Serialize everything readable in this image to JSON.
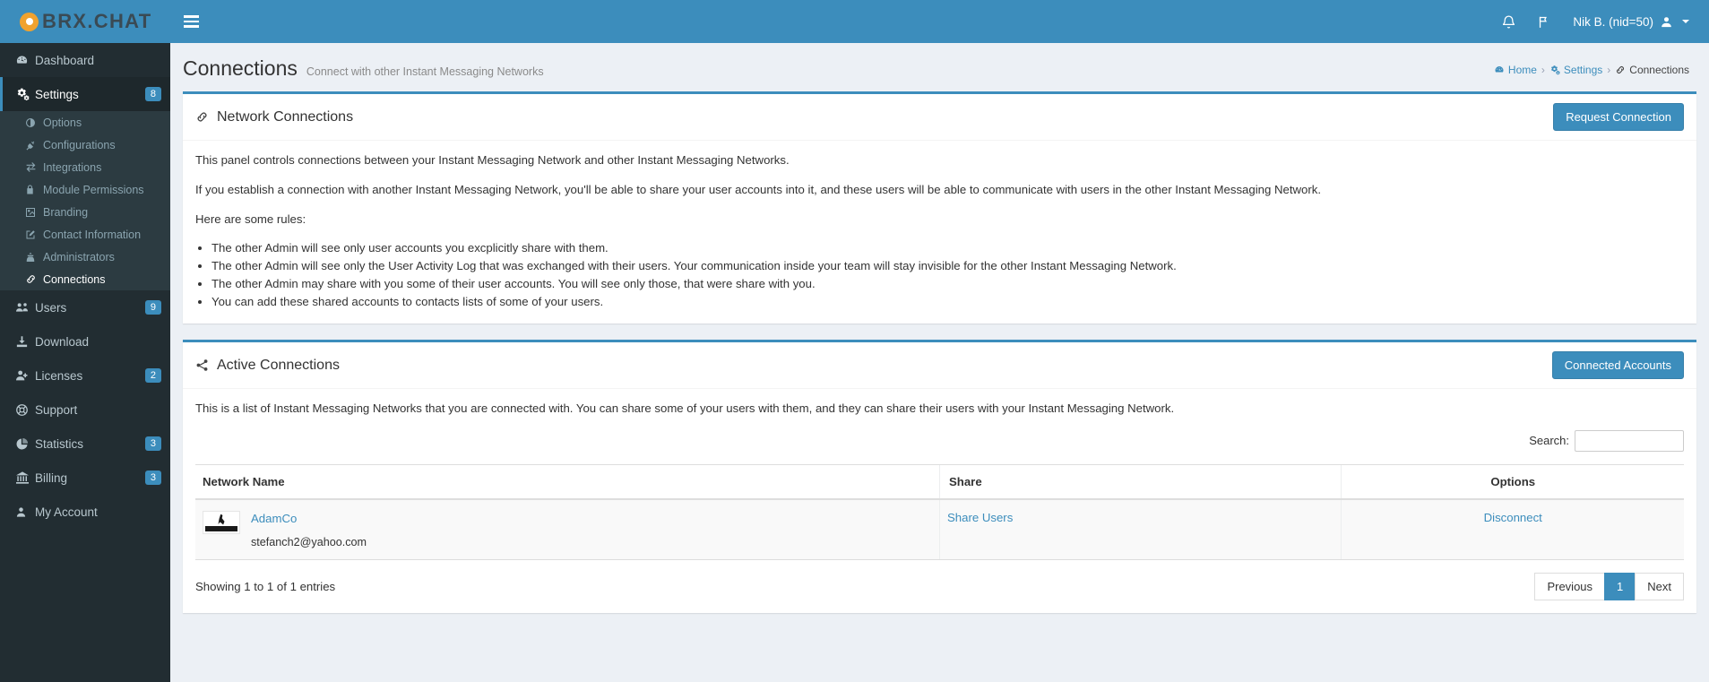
{
  "brand": {
    "name": "BRX.CHAT",
    "logo_icon": "circle-dot-icon",
    "accent": "#3c8dbc"
  },
  "topbar": {
    "menu_toggle_icon": "hamburger-icon",
    "bell_icon": "bell-icon",
    "flag_icon": "flag-icon",
    "user_label": "Nik B. (nid=50)",
    "user_icon": "user-icon",
    "caret_icon": "caret-down-icon"
  },
  "sidebar": {
    "items": [
      {
        "label": "Dashboard",
        "icon": "dashboard-icon",
        "badge": "",
        "active": false
      },
      {
        "label": "Settings",
        "icon": "gears-icon",
        "badge": "8",
        "active": true
      },
      {
        "label": "Users",
        "icon": "users-icon",
        "badge": "9",
        "active": false
      },
      {
        "label": "Download",
        "icon": "download-icon",
        "badge": "",
        "active": false
      },
      {
        "label": "Licenses",
        "icon": "user-plus-icon",
        "badge": "2",
        "active": false
      },
      {
        "label": "Support",
        "icon": "lifebuoy-icon",
        "badge": "",
        "active": false
      },
      {
        "label": "Statistics",
        "icon": "pie-chart-icon",
        "badge": "3",
        "active": false
      },
      {
        "label": "Billing",
        "icon": "bank-icon",
        "badge": "3",
        "active": false
      },
      {
        "label": "My Account",
        "icon": "user-icon",
        "badge": "",
        "active": false
      }
    ],
    "settings_submenu": [
      {
        "label": "Options",
        "icon": "adjust-icon",
        "active": false
      },
      {
        "label": "Configurations",
        "icon": "plug-icon",
        "active": false
      },
      {
        "label": "Integrations",
        "icon": "exchange-icon",
        "active": false
      },
      {
        "label": "Module Permissions",
        "icon": "lock-icon",
        "active": false
      },
      {
        "label": "Branding",
        "icon": "image-icon",
        "active": false
      },
      {
        "label": "Contact Information",
        "icon": "edit-icon",
        "active": false
      },
      {
        "label": "Administrators",
        "icon": "user-secret-icon",
        "active": false
      },
      {
        "label": "Connections",
        "icon": "link-icon",
        "active": true
      }
    ]
  },
  "page": {
    "title": "Connections",
    "subtitle": "Connect with other Instant Messaging Networks",
    "breadcrumb": [
      {
        "label": "Home",
        "icon": "dashboard-icon",
        "current": false
      },
      {
        "label": "Settings",
        "icon": "gears-icon",
        "current": false
      },
      {
        "label": "Connections",
        "icon": "link-icon",
        "current": true
      }
    ],
    "breadcrumb_separator": "›"
  },
  "network_panel": {
    "title": "Network Connections",
    "title_icon": "link-icon",
    "action_label": "Request Connection",
    "paragraph_1": "This panel controls connections between your Instant Messaging Network and other Instant Messaging Networks.",
    "paragraph_2": "If you establish a connection with another Instant Messaging Network, you'll be able to share your user accounts into it, and these users will be able to communicate with users in the other Instant Messaging Network.",
    "paragraph_3": "Here are some rules:",
    "rules": [
      "The other Admin will see only user accounts you excplicitly share with them.",
      "The other Admin will see only the User Activity Log that was exchanged with their users. Your communication inside your team will stay invisible for the other Instant Messaging Network.",
      "The other Admin may share with you some of their user accounts. You will see only those, that were share with you.",
      "You can add these shared accounts to contacts lists of some of your users."
    ]
  },
  "active_panel": {
    "title": "Active Connections",
    "title_icon": "share-alt-icon",
    "action_label": "Connected Accounts",
    "description": "This is a list of Instant Messaging Networks that you are connected with. You can share some of your users with them, and they can share their users with your Instant Messaging Network.",
    "search_label": "Search:",
    "search_value": "",
    "search_placeholder": "",
    "table": {
      "columns": [
        "Network Name",
        "Share",
        "Options"
      ],
      "rows": [
        {
          "logo_icon": "company-logo-icon",
          "network_name": "AdamCo",
          "email": "stefanch2@yahoo.com",
          "share_label": "Share Users",
          "option_label": "Disconnect"
        }
      ]
    },
    "entries_info": "Showing 1 to 1 of 1 entries",
    "pagination": {
      "previous_label": "Previous",
      "next_label": "Next",
      "pages": [
        "1"
      ],
      "current_page": "1"
    }
  }
}
